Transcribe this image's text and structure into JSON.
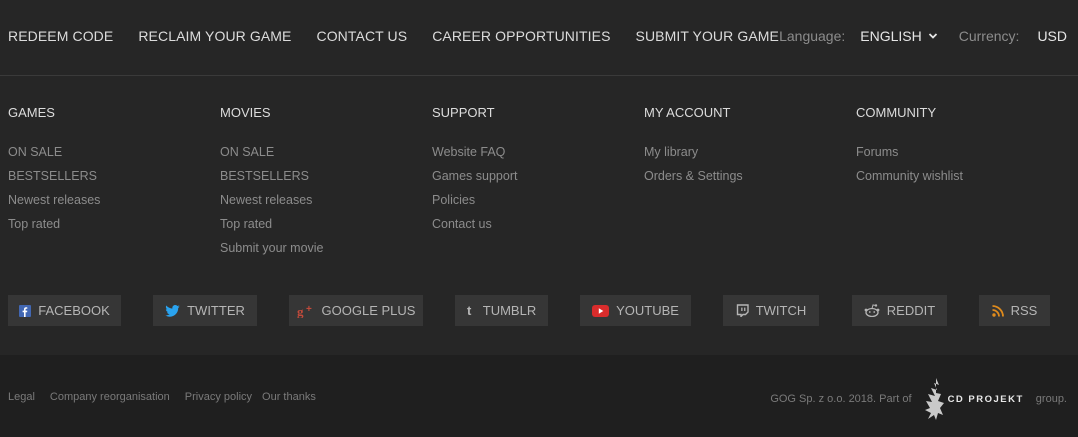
{
  "topbar": {
    "links": [
      "REDEEM CODE",
      "RECLAIM YOUR GAME",
      "CONTACT US",
      "CAREER OPPORTUNITIES",
      "SUBMIT YOUR GAME"
    ],
    "language_label": "Language:",
    "language_value": "ENGLISH",
    "currency_label": "Currency:",
    "currency_value": "USD"
  },
  "columns": [
    {
      "heading": "GAMES",
      "items": [
        "ON SALE",
        "BESTSELLERS",
        "Newest releases",
        "Top rated"
      ]
    },
    {
      "heading": "MOVIES",
      "items": [
        "ON SALE",
        "BESTSELLERS",
        "Newest releases",
        "Top rated",
        "Submit your movie"
      ]
    },
    {
      "heading": "SUPPORT",
      "items": [
        "Website FAQ",
        "Games support",
        "Policies",
        "Contact us"
      ]
    },
    {
      "heading": "MY ACCOUNT",
      "items": [
        "My library",
        "Orders & Settings"
      ]
    },
    {
      "heading": "COMMUNITY",
      "items": [
        "Forums",
        "Community wishlist"
      ]
    }
  ],
  "social": [
    {
      "label": "FACEBOOK",
      "icon": "facebook-icon"
    },
    {
      "label": "TWITTER",
      "icon": "twitter-icon"
    },
    {
      "label": "GOOGLE PLUS",
      "icon": "google-plus-icon"
    },
    {
      "label": "TUMBLR",
      "icon": "tumblr-icon"
    },
    {
      "label": "YOUTUBE",
      "icon": "youtube-icon"
    },
    {
      "label": "TWITCH",
      "icon": "twitch-icon"
    },
    {
      "label": "REDDIT",
      "icon": "reddit-icon"
    },
    {
      "label": "RSS",
      "icon": "rss-icon"
    }
  ],
  "bottom": {
    "legal_links": [
      "Legal",
      "Company reorganisation",
      "Privacy policy",
      "Our thanks"
    ],
    "copyright": "GOG Sp. z o.o. 2018. Part of",
    "brand_text": "CD PROJEKT",
    "copyright_suffix": "group."
  },
  "colors": {
    "background": "#262626",
    "bottom_background": "#1f1f1f",
    "button_background": "#363636",
    "facebook": "#4267b2",
    "twitter": "#2aa3ef",
    "google_plus": "#c24a3b",
    "youtube": "#d92c2c",
    "rss": "#e08b1c"
  }
}
